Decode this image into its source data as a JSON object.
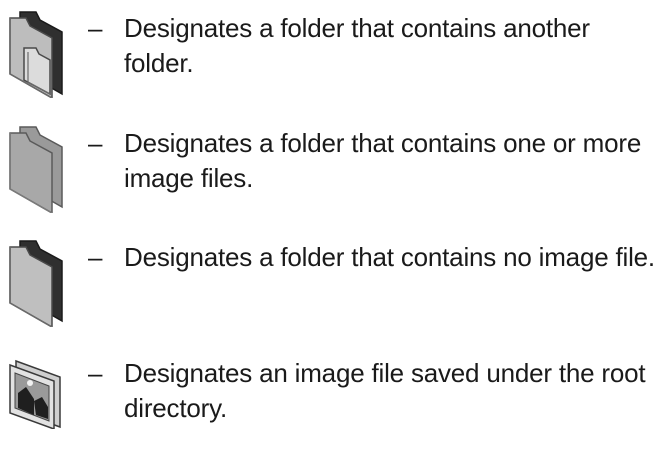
{
  "legend": {
    "items": [
      {
        "icon": "folder-with-subfolder-icon",
        "dash": "–",
        "text": "Designates a folder that contains another folder."
      },
      {
        "icon": "folder-with-images-icon",
        "dash": "–",
        "text": "Designates a folder that contains one or more image files."
      },
      {
        "icon": "empty-folder-icon",
        "dash": "–",
        "text": "Designates a folder that contains no image file."
      },
      {
        "icon": "image-file-icon",
        "dash": "–",
        "text": "Designates an image file saved under the root directory."
      }
    ]
  },
  "colors": {
    "text": "#1a1a1a",
    "folder_dark": "#3a3a3a",
    "folder_mid": "#8c8c8c",
    "folder_light": "#c8c8c8"
  }
}
